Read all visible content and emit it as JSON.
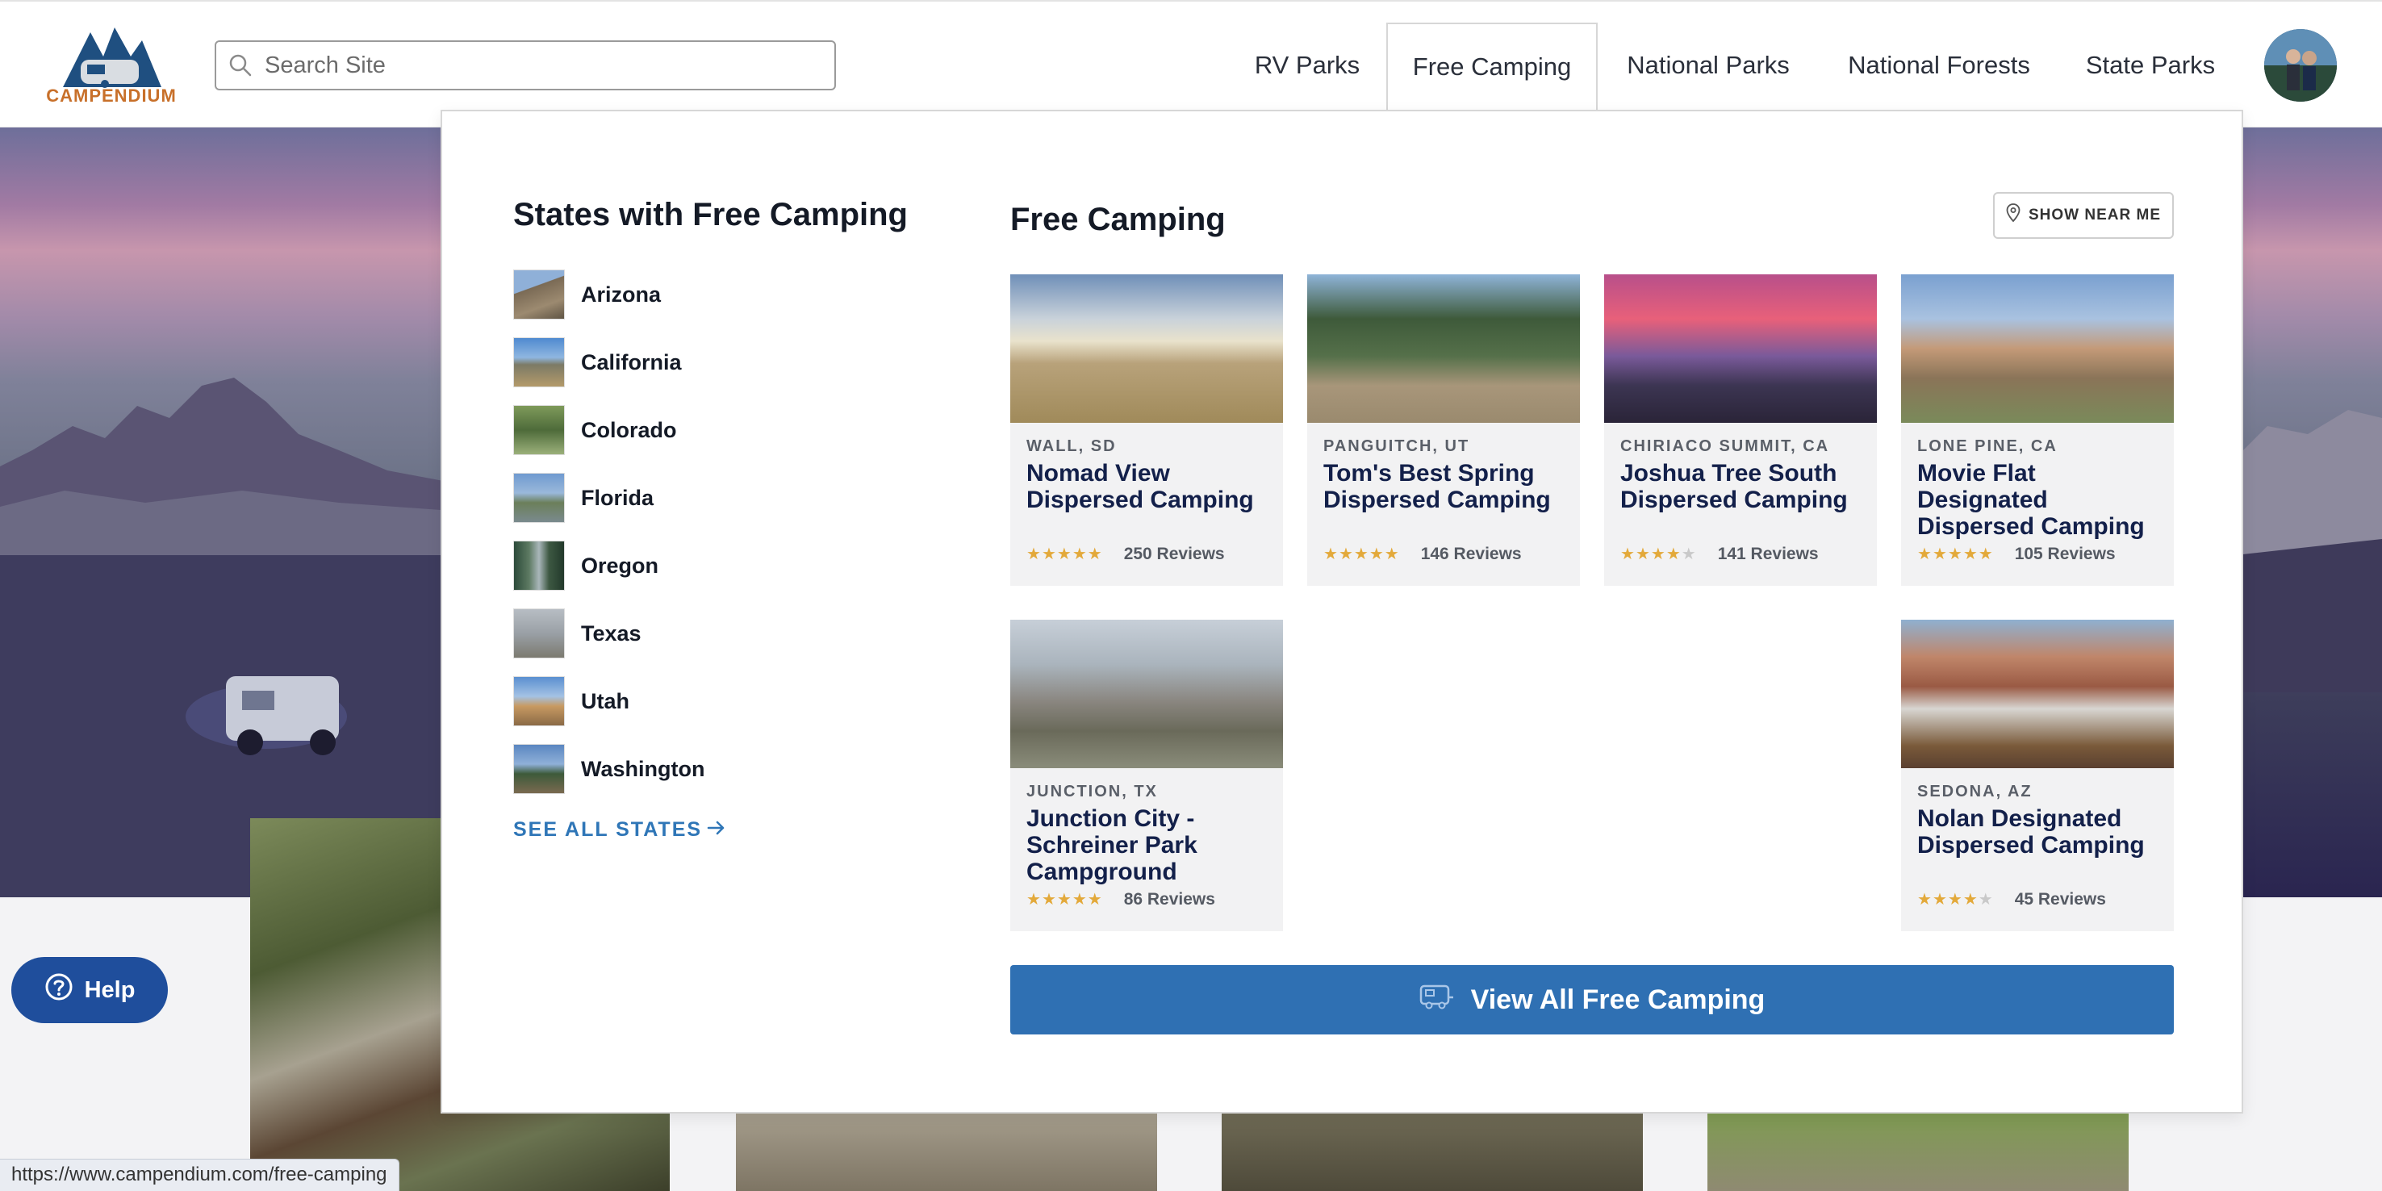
{
  "header": {
    "logo_text": "CAMPENDIUM",
    "search_placeholder": "Search Site",
    "nav": [
      {
        "label": "RV Parks"
      },
      {
        "label": "Free Camping"
      },
      {
        "label": "National Parks"
      },
      {
        "label": "National Forests"
      },
      {
        "label": "State Parks"
      }
    ]
  },
  "dropdown": {
    "states_title": "States with Free Camping",
    "states": [
      {
        "name": "Arizona"
      },
      {
        "name": "California"
      },
      {
        "name": "Colorado"
      },
      {
        "name": "Florida"
      },
      {
        "name": "Oregon"
      },
      {
        "name": "Texas"
      },
      {
        "name": "Utah"
      },
      {
        "name": "Washington"
      }
    ],
    "see_all_states": "SEE ALL STATES",
    "free_camping_title": "Free Camping",
    "show_near_me": "SHOW NEAR ME",
    "cards": [
      {
        "location": "WALL, SD",
        "name": "Nomad View Dispersed Camping",
        "rating": 5,
        "reviews": "250 Reviews"
      },
      {
        "location": "PANGUITCH, UT",
        "name": "Tom's Best Spring Dispersed Camping",
        "rating": 5,
        "reviews": "146 Reviews"
      },
      {
        "location": "CHIRIACO SUMMIT, CA",
        "name": "Joshua Tree South Dispersed Camping",
        "rating": 4,
        "reviews": "141 Reviews"
      },
      {
        "location": "LONE PINE, CA",
        "name": "Movie Flat Designated Dispersed Camping",
        "rating": 5,
        "reviews": "105 Reviews"
      },
      {
        "location": "JUNCTION, TX",
        "name": "Junction City - Schreiner Park Campground",
        "rating": 5,
        "reviews": "86 Reviews"
      },
      {
        "location": "SEDONA, AZ",
        "name": "Nolan Designated Dispersed Camping",
        "rating": 4,
        "reviews": "45 Reviews"
      }
    ],
    "view_all": "View All Free Camping"
  },
  "help_label": "Help",
  "status_url": "https://www.campendium.com/free-camping",
  "colors": {
    "brand_blue": "#2f70b3",
    "logo_orange": "#c8702a",
    "star_gold": "#e3a93a",
    "help_blue": "#1f4e9c"
  }
}
